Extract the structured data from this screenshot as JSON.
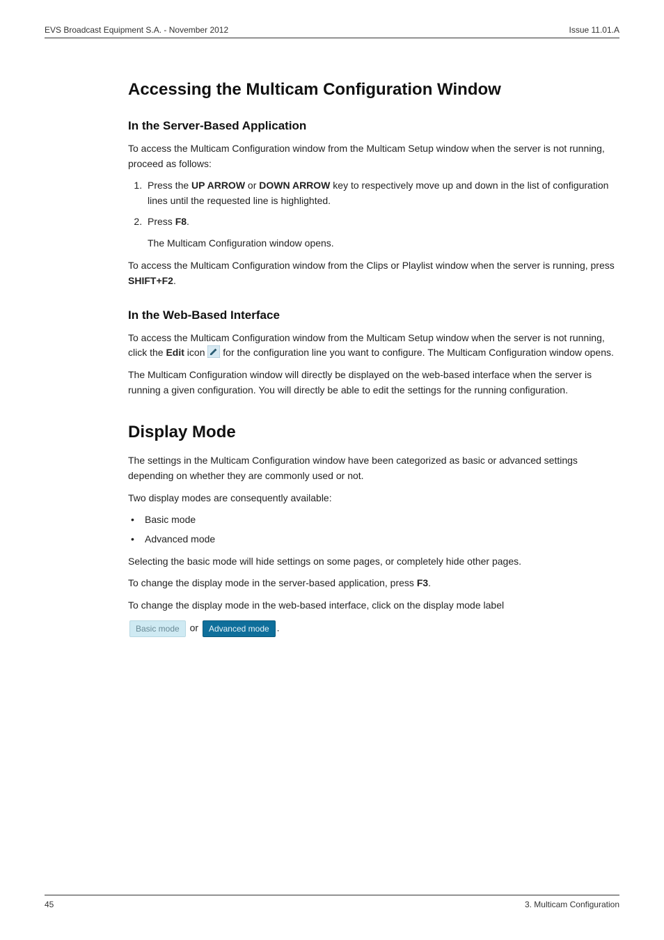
{
  "header": {
    "left": "EVS Broadcast Equipment S.A. - November 2012",
    "right": "Issue 11.01.A"
  },
  "section1": {
    "title": "Accessing the Multicam Configuration Window",
    "sub1": {
      "title": "In the Server-Based Application",
      "p1": "To access the Multicam Configuration window from the Multicam Setup window when the server is not running, proceed as follows:",
      "step1_pre": "Press the ",
      "step1_k1": "UP ARROW",
      "step1_mid": " or ",
      "step1_k2": "DOWN ARROW",
      "step1_post": " key to respectively move up and down in the list of configuration lines until the requested line is highlighted.",
      "step2_pre": "Press ",
      "step2_k": "F8",
      "step2_post": ".",
      "step2_result": "The Multicam Configuration window opens.",
      "p2_pre": "To access the Multicam Configuration window from the Clips or Playlist window when the server is running, press ",
      "p2_k": "SHIFT+F2",
      "p2_post": "."
    },
    "sub2": {
      "title": "In the Web-Based Interface",
      "p1_pre": "To access the Multicam Configuration window from the Multicam Setup window when the server is not running, click the ",
      "p1_b": "Edit",
      "p1_mid": " icon ",
      "p1_post": " for the configuration line you want to configure. The Multicam Configuration window opens.",
      "p2": "The Multicam Configuration window will directly be displayed on the web-based interface when the server is running a given configuration. You will directly be able to edit the settings for the running configuration."
    }
  },
  "section2": {
    "title": "Display Mode",
    "p1": "The settings in the Multicam Configuration window have been categorized as basic or advanced settings depending on whether they are commonly used or not.",
    "p2": "Two display modes are consequently available:",
    "bullet1": "Basic mode",
    "bullet2": "Advanced mode",
    "p3": "Selecting the basic mode will hide settings on some pages, or completely hide other pages.",
    "p4_pre": "To change the display mode in the server-based application, press ",
    "p4_k": "F3",
    "p4_post": ".",
    "p5": "To change the display mode in the web-based interface, click on the display mode label",
    "label_basic": "Basic mode",
    "label_or": " or ",
    "label_advanced": "Advanced mode",
    "label_end": "."
  },
  "footer": {
    "left": "45",
    "right": "3. Multicam Configuration"
  }
}
